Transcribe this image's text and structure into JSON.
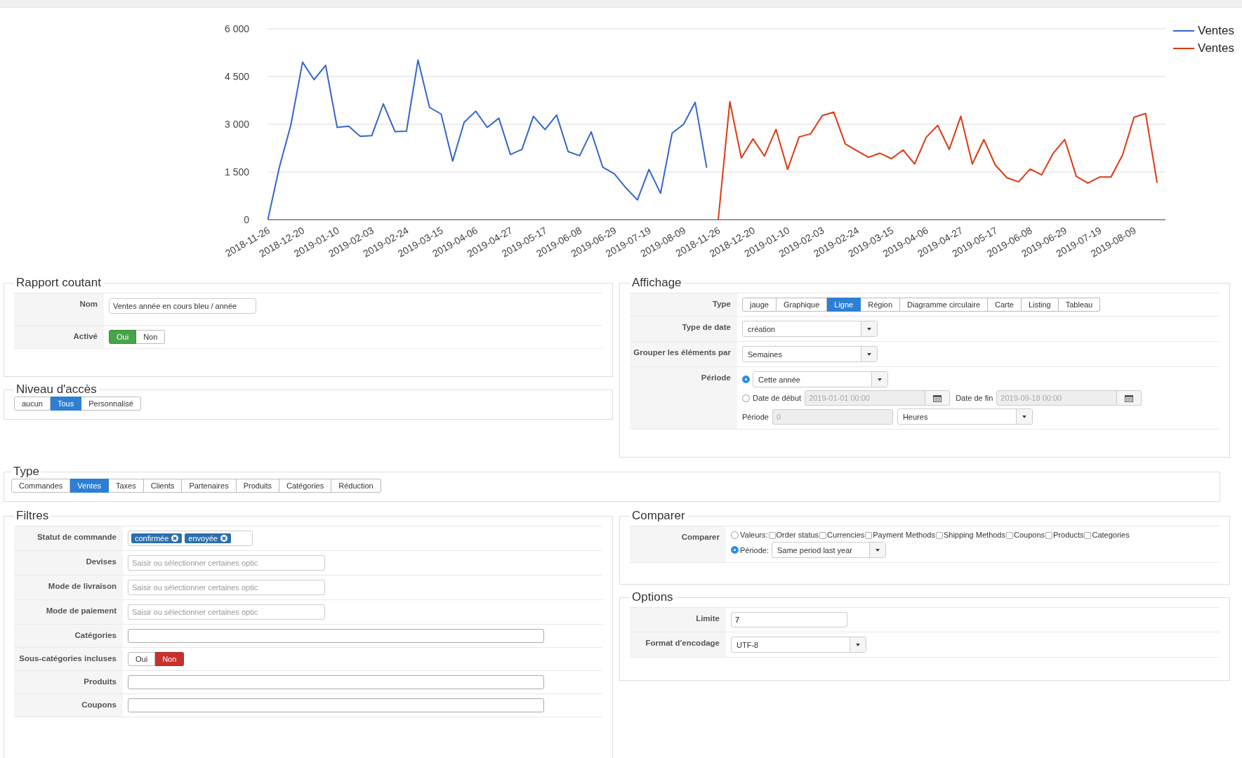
{
  "chart": {
    "chart_data": {
      "type": "line",
      "categories": [
        "2018-11-26",
        null,
        null,
        "2018-12-20",
        null,
        null,
        "2019-01-10",
        null,
        null,
        "2019-02-03",
        null,
        null,
        "2019-02-24",
        null,
        null,
        "2019-03-15",
        null,
        null,
        "2019-04-06",
        null,
        null,
        "2019-04-27",
        null,
        null,
        "2019-05-17",
        null,
        null,
        "2019-06-08",
        null,
        null,
        "2019-06-29",
        null,
        null,
        "2019-07-19",
        null,
        null,
        "2019-08-09",
        null,
        null,
        "2018-11-26",
        null,
        null,
        "2018-12-20",
        null,
        null,
        "2019-01-10",
        null,
        null,
        "2019-02-03",
        null,
        null,
        "2019-02-24",
        null,
        null,
        "2019-03-15",
        null,
        null,
        "2019-04-06",
        null,
        null,
        "2019-04-27",
        null,
        null,
        "2019-05-17",
        null,
        null,
        "2019-06-08",
        null,
        null,
        "2019-06-29",
        null,
        null,
        "2019-07-19",
        null,
        null,
        "2019-08-09",
        null,
        null
      ],
      "ylim": [
        0,
        6000
      ],
      "grid": true,
      "yticks": [
        {
          "value": 0,
          "label": "0"
        },
        {
          "value": 1500,
          "label": "1 500"
        },
        {
          "value": 3000,
          "label": "3 000"
        },
        {
          "value": 4500,
          "label": "4 500"
        },
        {
          "value": 6000,
          "label": "6 000"
        }
      ],
      "series": [
        {
          "name": "Ventes",
          "color": "#3366cc",
          "values": [
            0,
            1650,
            2990,
            4950,
            4400,
            4850,
            2900,
            2940,
            2620,
            2640,
            3640,
            2770,
            2780,
            5020,
            3530,
            3320,
            1840,
            3060,
            3410,
            2900,
            3190,
            2050,
            2210,
            3250,
            2830,
            3290,
            2140,
            2010,
            2760,
            1650,
            1440,
            1000,
            620,
            1580,
            830,
            2720,
            3000,
            3690,
            1630,
            null,
            null,
            null,
            null,
            null,
            null,
            null,
            null,
            null,
            null,
            null,
            null,
            null,
            null,
            null,
            null,
            null,
            null,
            null,
            null,
            null,
            null,
            null,
            null,
            null,
            null,
            null,
            null,
            null,
            null,
            null,
            null,
            null,
            null,
            null,
            null,
            null,
            null,
            null
          ]
        },
        {
          "name": "Ventes",
          "color": "#dc3912",
          "values": [
            null,
            null,
            null,
            null,
            null,
            null,
            null,
            null,
            null,
            null,
            null,
            null,
            null,
            null,
            null,
            null,
            null,
            null,
            null,
            null,
            null,
            null,
            null,
            null,
            null,
            null,
            null,
            null,
            null,
            null,
            null,
            null,
            null,
            null,
            null,
            null,
            null,
            null,
            null,
            0,
            3710,
            1940,
            2540,
            2000,
            2840,
            1580,
            2600,
            2700,
            3270,
            3380,
            2380,
            2170,
            1960,
            2090,
            1920,
            2190,
            1750,
            2590,
            2960,
            2210,
            3250,
            1750,
            2520,
            1710,
            1320,
            1190,
            1590,
            1410,
            2090,
            2520,
            1360,
            1150,
            1340,
            1340,
            2030,
            3220,
            3340,
            1160
          ]
        }
      ]
    }
  },
  "rapport": {
    "title": "Rapport coutant",
    "fields": [
      {
        "kind": "text",
        "label": "Nom",
        "value": "Ventes année en cours bleu / année"
      },
      {
        "kind": "toggle",
        "label": "Activé",
        "options": [
          {
            "label": "Oui",
            "kind": "yes",
            "selected": true
          },
          {
            "label": "Non",
            "selected": false
          }
        ]
      }
    ]
  },
  "acces": {
    "title": "Niveau d'accès",
    "options": [
      {
        "label": "aucun",
        "selected": false
      },
      {
        "label": "Tous",
        "selected": true
      },
      {
        "label": "Personnalisé",
        "selected": false
      }
    ]
  },
  "affichage": {
    "title": "Affichage",
    "fields": [
      {
        "kind": "buttons",
        "label": "Type",
        "options": [
          {
            "label": "jauge",
            "selected": false
          },
          {
            "label": "Graphique",
            "selected": false
          },
          {
            "label": "Ligne",
            "selected": true
          },
          {
            "label": "Région",
            "selected": false
          },
          {
            "label": "Diagramme circulaire",
            "selected": false
          },
          {
            "label": "Carte",
            "selected": false
          },
          {
            "label": "Listing",
            "selected": false
          },
          {
            "label": "Tableau",
            "selected": false
          }
        ]
      },
      {
        "kind": "select",
        "label": "Type de date",
        "value": "création"
      },
      {
        "kind": "select",
        "label": "Grouper les éléments par",
        "value": "Semaines"
      },
      {
        "kind": "period",
        "label": "Période",
        "preset": {
          "selected": true,
          "value": "Cette année"
        },
        "range": {
          "selected": false,
          "disabled": true,
          "start_label": "Date de début",
          "start": "2019-01-01 00:00",
          "end_label": "Date de fin",
          "end": "2019-09-18 00:00"
        },
        "relative": {
          "label": "Période",
          "disabled": true,
          "value": "0",
          "unit": "Heures"
        }
      }
    ]
  },
  "type": {
    "title": "Type",
    "options": [
      {
        "label": "Commandes",
        "selected": false
      },
      {
        "label": "Ventes",
        "selected": true
      },
      {
        "label": "Taxes",
        "selected": false
      },
      {
        "label": "Clients",
        "selected": false
      },
      {
        "label": "Partenaires",
        "selected": false
      },
      {
        "label": "Produits",
        "selected": false
      },
      {
        "label": "Catégories",
        "selected": false
      },
      {
        "label": "Réduction",
        "selected": false
      }
    ]
  },
  "filtres": {
    "title": "Filtres",
    "fields": [
      {
        "kind": "tags",
        "label": "Statut de commande",
        "tags": [
          "confirmée",
          "envoyée"
        ]
      },
      {
        "kind": "multi",
        "label": "Devises",
        "placeholder": "Saisir ou sélectionner certaines optic"
      },
      {
        "kind": "multi",
        "label": "Mode de livraison",
        "placeholder": "Saisir ou sélectionner certaines optic"
      },
      {
        "kind": "multi",
        "label": "Mode de paiement",
        "placeholder": "Saisir ou sélectionner certaines optic"
      },
      {
        "kind": "wide",
        "label": "Catégories"
      },
      {
        "kind": "toggle",
        "label": "Sous-catégories incluses",
        "options": [
          {
            "label": "Oui",
            "selected": false
          },
          {
            "label": "Non",
            "kind": "no",
            "selected": true
          }
        ]
      },
      {
        "kind": "wide",
        "label": "Produits"
      },
      {
        "kind": "wide",
        "label": "Coupons"
      }
    ]
  },
  "comparer": {
    "title": "Comparer",
    "fields": [
      {
        "kind": "compare",
        "label": "Comparer",
        "values": {
          "label": "Valeurs:",
          "selected": false,
          "options": [
            {
              "label": "Order status",
              "checked": false
            },
            {
              "label": "Currencies",
              "checked": false
            },
            {
              "label": "Payment Methods",
              "checked": false
            },
            {
              "label": "Shipping Methods",
              "checked": false
            },
            {
              "label": "Coupons",
              "checked": false
            },
            {
              "label": "Products",
              "checked": false
            },
            {
              "label": "Categories",
              "checked": false
            }
          ]
        },
        "period": {
          "label": "Période:",
          "selected": true,
          "value": "Same period last year"
        }
      }
    ]
  },
  "options": {
    "title": "Options",
    "fields": [
      {
        "kind": "text",
        "label": "Limite",
        "value": "7"
      },
      {
        "kind": "select",
        "label": "Format d'encodage",
        "value": "UTF-8"
      }
    ]
  }
}
